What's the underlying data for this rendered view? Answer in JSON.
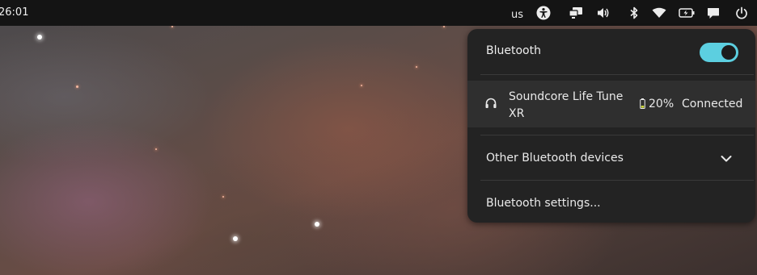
{
  "top_bar": {
    "clock": "26:01",
    "keyboard_layout": "us",
    "icons": [
      "accessibility-icon",
      "screen-share-icon",
      "volume-icon",
      "bluetooth-icon",
      "wifi-icon",
      "battery-icon",
      "notifications-icon",
      "power-icon"
    ]
  },
  "bluetooth_panel": {
    "title": "Bluetooth",
    "enabled": true,
    "accent_color": "#5ccfe0",
    "device": {
      "icon": "headphones-icon",
      "name": "Soundcore Life Tune XR",
      "battery": "20%",
      "status": "Connected"
    },
    "other_devices_label": "Other Bluetooth devices",
    "settings_label": "Bluetooth settings..."
  }
}
